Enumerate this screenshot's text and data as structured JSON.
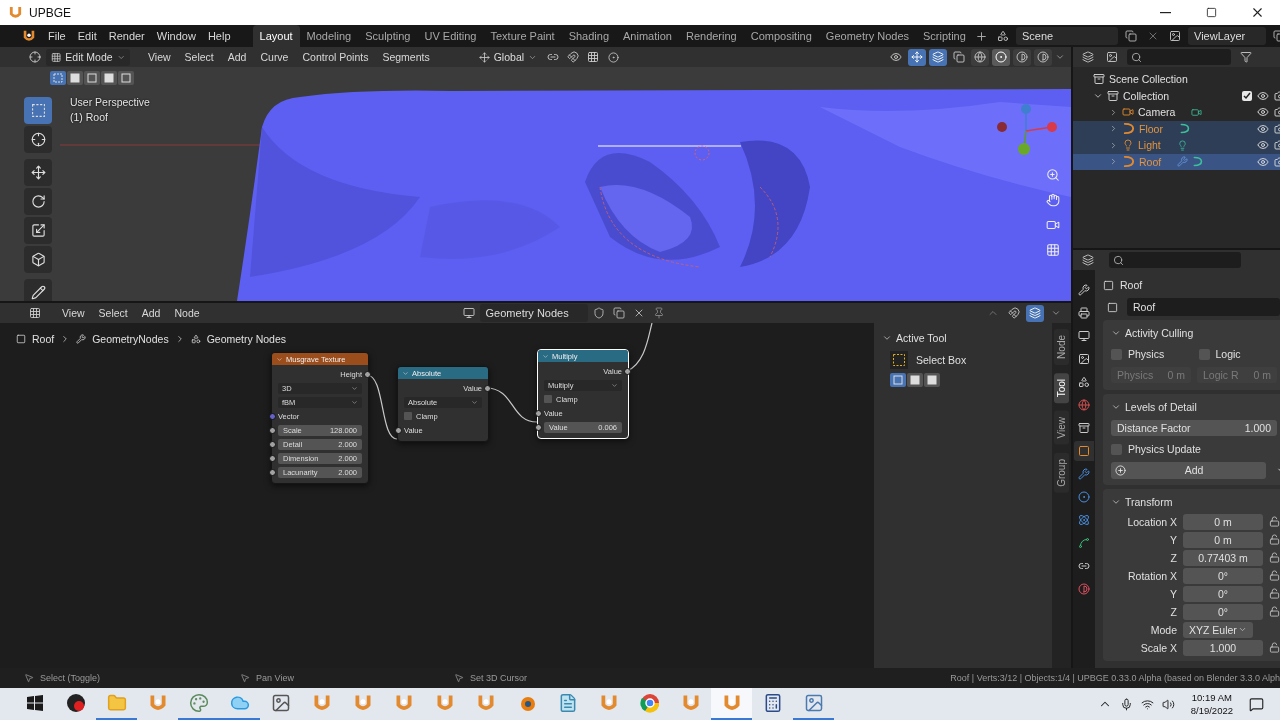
{
  "window": {
    "title": "UPBGE"
  },
  "menu": [
    "File",
    "Edit",
    "Render",
    "Window",
    "Help"
  ],
  "workspaces": [
    {
      "label": "Layout",
      "selected": true
    },
    {
      "label": "Modeling",
      "selected": false
    },
    {
      "label": "Sculpting",
      "selected": false
    },
    {
      "label": "UV Editing",
      "selected": false
    },
    {
      "label": "Texture Paint",
      "selected": false
    },
    {
      "label": "Shading",
      "selected": false
    },
    {
      "label": "Animation",
      "selected": false
    },
    {
      "label": "Rendering",
      "selected": false
    },
    {
      "label": "Compositing",
      "selected": false
    },
    {
      "label": "Geometry Nodes",
      "selected": false
    },
    {
      "label": "Scripting",
      "selected": false
    }
  ],
  "scene": "Scene",
  "view_layer": "ViewLayer",
  "viewport": {
    "mode": "Edit Mode",
    "menus": [
      "View",
      "Select",
      "Add",
      "Curve",
      "Control Points",
      "Segments"
    ],
    "orientation": "Global",
    "select_modes": [
      {
        "selected": true
      },
      {
        "selected": false
      },
      {
        "selected": false
      },
      {
        "selected": false
      },
      {
        "selected": false
      }
    ],
    "shading": [
      {
        "selected": false
      },
      {
        "selected": true
      },
      {
        "selected": false
      },
      {
        "selected": false
      }
    ],
    "view_name": "User Perspective",
    "object_label": "(1) Roof",
    "tools": [
      {
        "selected": true
      },
      {
        "selected": false
      },
      {
        "selected": false
      },
      {
        "selected": false
      },
      {
        "selected": false
      },
      {
        "selected": false
      },
      {
        "selected": false
      }
    ]
  },
  "outliner": {
    "root": "Scene Collection",
    "collection": {
      "label": "Collection",
      "checked": true,
      "expanded": true,
      "children": [
        {
          "label": "Camera",
          "kind": "camera",
          "selected": false,
          "active": false
        },
        {
          "label": "Floor",
          "kind": "curve",
          "selected": true,
          "active": false
        },
        {
          "label": "Light",
          "kind": "light",
          "selected": true,
          "active": false
        },
        {
          "label": "Roof",
          "kind": "curve",
          "selected": true,
          "active": true
        }
      ]
    }
  },
  "node_editor": {
    "menus": [
      "View",
      "Select",
      "Add",
      "Node"
    ],
    "tree": "Geometry Nodes",
    "breadcrumbs": [
      "Roof",
      "GeometryNodes",
      "Geometry Nodes"
    ],
    "nodes": [
      {
        "title": "Musgrave Texture",
        "kind": "texture",
        "selected": false,
        "rows": [
          {
            "kind": "output",
            "label": "Height"
          },
          {
            "kind": "dropdown",
            "value": "3D"
          },
          {
            "kind": "dropdown",
            "value": "fBM"
          },
          {
            "kind": "socket",
            "label": "Vector",
            "color": "#6363c7"
          },
          {
            "kind": "field",
            "label": "Scale",
            "value": "128.000"
          },
          {
            "kind": "field",
            "label": "Detail",
            "value": "2.000"
          },
          {
            "kind": "field",
            "label": "Dimension",
            "value": "2.000"
          },
          {
            "kind": "field",
            "label": "Lacunarity",
            "value": "2.000"
          }
        ]
      },
      {
        "title": "Absolute",
        "kind": "math",
        "selected": false,
        "rows": [
          {
            "kind": "output",
            "label": "Value"
          },
          {
            "kind": "dropdown",
            "value": "Absolute"
          },
          {
            "kind": "checkbox",
            "label": "Clamp",
            "checked": false
          },
          {
            "kind": "socket",
            "label": "Value",
            "color": "#a1a1a1"
          }
        ]
      },
      {
        "title": "Multiply",
        "kind": "math",
        "selected": true,
        "rows": [
          {
            "kind": "output",
            "label": "Value"
          },
          {
            "kind": "dropdown",
            "value": "Multiply"
          },
          {
            "kind": "checkbox",
            "label": "Clamp",
            "checked": false
          },
          {
            "kind": "socket",
            "label": "Value",
            "color": "#a1a1a1"
          },
          {
            "kind": "field",
            "label": "Value",
            "value": "0.006"
          }
        ]
      }
    ],
    "sidebar": {
      "tabs": [
        {
          "label": "Node",
          "selected": false
        },
        {
          "label": "Tool",
          "selected": true
        },
        {
          "label": "View",
          "selected": false
        },
        {
          "label": "Group",
          "selected": false
        }
      ],
      "panel": "Active Tool",
      "tool": "Select Box",
      "tool_modes": [
        {
          "selected": true
        },
        {
          "selected": false
        },
        {
          "selected": false
        }
      ]
    }
  },
  "properties": {
    "tabs": [
      {
        "selected": false
      },
      {
        "selected": false
      },
      {
        "selected": false
      },
      {
        "selected": false
      },
      {
        "selected": false
      },
      {
        "selected": false
      },
      {
        "selected": false
      },
      {
        "selected": true
      },
      {
        "selected": false
      },
      {
        "selected": false
      },
      {
        "selected": false
      },
      {
        "selected": false
      },
      {
        "selected": false
      },
      {
        "selected": false
      }
    ],
    "object": "Roof",
    "name": "Roof",
    "panels": [
      {
        "title": "Activity Culling",
        "expanded": true,
        "rows": [
          {
            "kind": "checks",
            "items": [
              {
                "label": "Physics",
                "checked": false
              },
              {
                "label": "Logic",
                "checked": false
              }
            ]
          },
          {
            "kind": "fields",
            "items": [
              {
                "label": "Physics",
                "value": "0 m",
                "disabled": true
              },
              {
                "label": "Logic R",
                "value": "0 m",
                "disabled": true
              }
            ]
          }
        ]
      },
      {
        "title": "Levels of Detail",
        "expanded": true,
        "rows": [
          {
            "kind": "slider",
            "label": "Distance Factor",
            "value": "1.000"
          },
          {
            "kind": "check",
            "label": "Physics Update",
            "checked": false
          },
          {
            "kind": "add",
            "label": "Add"
          }
        ]
      },
      {
        "title": "Transform",
        "expanded": true,
        "rows": [
          {
            "kind": "prop",
            "label": "Location X",
            "value": "0 m",
            "locked": false
          },
          {
            "kind": "prop",
            "label": "Y",
            "value": "0 m",
            "locked": false
          },
          {
            "kind": "prop",
            "label": "Z",
            "value": "0.77403 m",
            "locked": false
          },
          {
            "kind": "prop",
            "label": "Rotation X",
            "value": "0°",
            "locked": false
          },
          {
            "kind": "prop",
            "label": "Y",
            "value": "0°",
            "locked": false
          },
          {
            "kind": "prop",
            "label": "Z",
            "value": "0°",
            "locked": false
          },
          {
            "kind": "select",
            "label": "Mode",
            "value": "XYZ Euler"
          },
          {
            "kind": "prop",
            "label": "Scale X",
            "value": "1.000",
            "locked": false
          }
        ]
      }
    ]
  },
  "status_bar": {
    "hints": [
      "Select (Toggle)",
      "Pan View",
      "Set 3D Cursor"
    ],
    "info": "Roof | Verts:3/12 | Objects:1/4 | UPBGE 0.33.0 Alpha (based on Blender 3.3.0 Alph"
  },
  "taskbar": {
    "apps": [
      {
        "running": false
      },
      {
        "running": false
      },
      {
        "running": true
      },
      {
        "running": false
      },
      {
        "running": true
      },
      {
        "running": true
      },
      {
        "running": false
      },
      {
        "running": false
      },
      {
        "running": false
      },
      {
        "running": false
      },
      {
        "running": false
      },
      {
        "running": false
      },
      {
        "running": false
      },
      {
        "running": false
      },
      {
        "running": false
      },
      {
        "running": false
      },
      {
        "running": false
      },
      {
        "running": true
      },
      {
        "running": false
      },
      {
        "running": true
      }
    ],
    "time": "10:19 AM",
    "date": "8/19/2022"
  }
}
